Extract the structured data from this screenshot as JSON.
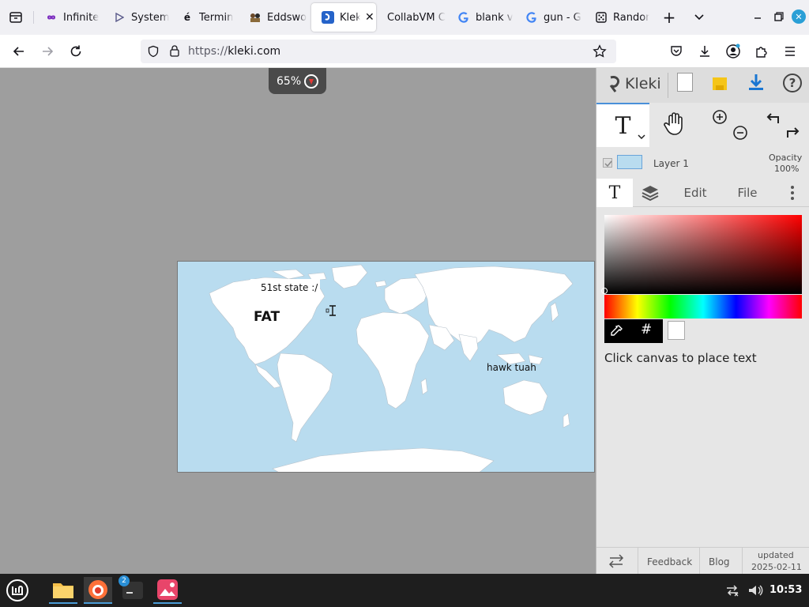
{
  "browser": {
    "tabs": [
      {
        "label": "Infinite",
        "icon": "infinity-icon"
      },
      {
        "label": "System",
        "icon": "play-icon"
      },
      {
        "label": "Termin",
        "icon": "e-acute-icon"
      },
      {
        "label": "Eddswo",
        "icon": "game-icon"
      },
      {
        "label": "Kleki",
        "icon": "kleki-icon",
        "active": true
      },
      {
        "label": "CollabVM C",
        "icon": "none"
      },
      {
        "label": "blank v",
        "icon": "google-icon"
      },
      {
        "label": "gun - G",
        "icon": "google-icon"
      },
      {
        "label": "Randon",
        "icon": "dice-icon"
      }
    ],
    "url_scheme": "https://",
    "url_host": "kleki.com"
  },
  "canvas": {
    "zoom_label": "65%",
    "texts": {
      "state": "51st state :/",
      "fat": "FAT",
      "hawk": "hawk tuah"
    }
  },
  "panel": {
    "logo": "Kleki",
    "layer_name": "Layer 1",
    "opacity_label": "Opacity",
    "opacity_value": "100%",
    "tabs": {
      "edit": "Edit",
      "file": "File"
    },
    "hint": "Click canvas to place text",
    "footer": {
      "feedback": "Feedback",
      "blog": "Blog",
      "updated_label": "updated",
      "updated_date": "2025-02-11"
    }
  },
  "taskbar": {
    "badge": "2",
    "clock": "10:53"
  },
  "colors": {
    "accent": "#0060df",
    "ocean": "#b9dcef",
    "workspace": "#9e9e9e"
  }
}
